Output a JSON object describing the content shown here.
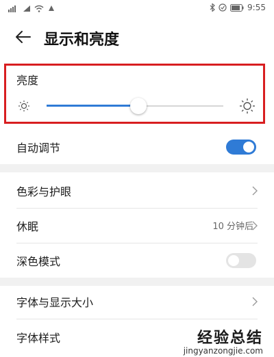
{
  "status_bar": {
    "time": "9:55",
    "icons": [
      "sim-signal-icon",
      "signal-icon",
      "wifi-icon",
      "notification-icon",
      "bluetooth-icon",
      "vibrate-icon",
      "battery-icon"
    ]
  },
  "header": {
    "title": "显示和亮度",
    "back_icon": "arrow-left-icon"
  },
  "brightness": {
    "label": "亮度",
    "level": 0.52,
    "highlight_color": "#d81e20",
    "accent": "#2f7bd6"
  },
  "rows": [
    {
      "label": "自动调节",
      "toggle": true
    },
    {
      "label": "色彩与护眼",
      "chevron": true
    },
    {
      "label": "休眠",
      "value": "10 分钟后",
      "chevron": true
    },
    {
      "label": "深色模式",
      "toggle": false
    },
    {
      "label": "字体与显示大小",
      "chevron": true
    },
    {
      "label": "字体样式",
      "chevron": true
    }
  ],
  "watermark": {
    "main": "经验总结",
    "sub": "jingyanzongjie.com"
  }
}
